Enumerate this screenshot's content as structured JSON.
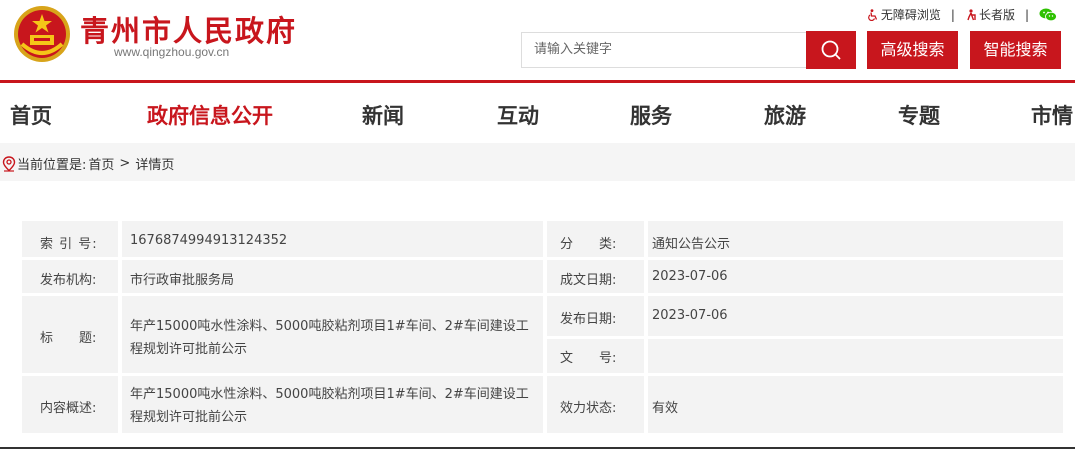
{
  "header": {
    "site_title": "青州市人民政府",
    "site_url": "www.qingzhou.gov.cn",
    "top_links": {
      "accessible": "无障碍浏览",
      "elderly": "长者版"
    },
    "search": {
      "placeholder": "请输入关键字"
    },
    "advanced_search_label": "高级搜索",
    "smart_search_label": "智能搜索"
  },
  "nav": {
    "items": [
      {
        "label": "首页"
      },
      {
        "label": "政府信息公开"
      },
      {
        "label": "新闻"
      },
      {
        "label": "互动"
      },
      {
        "label": "服务"
      },
      {
        "label": "旅游"
      },
      {
        "label": "专题"
      },
      {
        "label": "市情"
      }
    ]
  },
  "breadcrumb": {
    "prefix": "当前位置是:",
    "home": "首页",
    "separator": ">",
    "current": "详情页"
  },
  "info": {
    "index_label": "索 引 号:",
    "index_value": "1676874994913124352",
    "category_label": "分　　类:",
    "category_value": "通知公告公示",
    "org_label": "发布机构:",
    "org_value": "市行政审批服务局",
    "created_label": "成文日期:",
    "created_value": "2023-07-06",
    "title_label": "标　　题:",
    "title_value": "年产15000吨水性涂料、5000吨胶粘剂项目1#车间、2#车间建设工程规划许可批前公示",
    "published_label": "发布日期:",
    "published_value": "2023-07-06",
    "doc_no_label": "文　　号:",
    "doc_no_value": "",
    "summary_label": "内容概述:",
    "summary_value": "年产15000吨水性涂料、5000吨胶粘剂项目1#车间、2#车间建设工程规划许可批前公示",
    "status_label": "效力状态:",
    "status_value": "有效"
  },
  "colors": {
    "brand_red": "#c8161d",
    "wechat_green": "#2dc100"
  }
}
